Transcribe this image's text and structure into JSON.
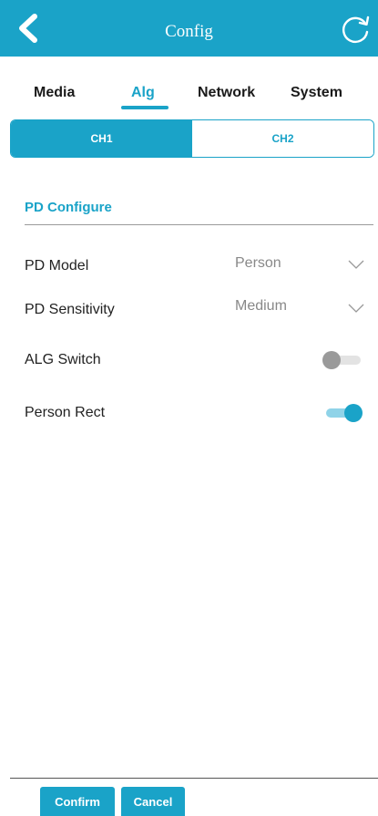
{
  "colors": {
    "accent": "#1aa3c8",
    "header_text": "#ffffff",
    "value_text": "#888888"
  },
  "header": {
    "title": "Config",
    "back_icon": "chevron-left-icon",
    "refresh_icon": "refresh-icon"
  },
  "tabs": [
    {
      "label": "Media",
      "active": false
    },
    {
      "label": "Alg",
      "active": true
    },
    {
      "label": "Network",
      "active": false
    },
    {
      "label": "System",
      "active": false
    }
  ],
  "channels": [
    {
      "label": "CH1",
      "selected": true
    },
    {
      "label": "CH2",
      "selected": false
    }
  ],
  "section": {
    "title": "PD Configure"
  },
  "settings": {
    "pd_model": {
      "label": "PD Model",
      "value": "Person"
    },
    "pd_sensitivity": {
      "label": "PD Sensitivity",
      "value": "Medium"
    },
    "alg_switch": {
      "label": "ALG Switch",
      "on": false
    },
    "person_rect": {
      "label": "Person Rect",
      "on": true
    }
  },
  "footer": {
    "confirm_label": "Confirm",
    "cancel_label": "Cancel"
  }
}
